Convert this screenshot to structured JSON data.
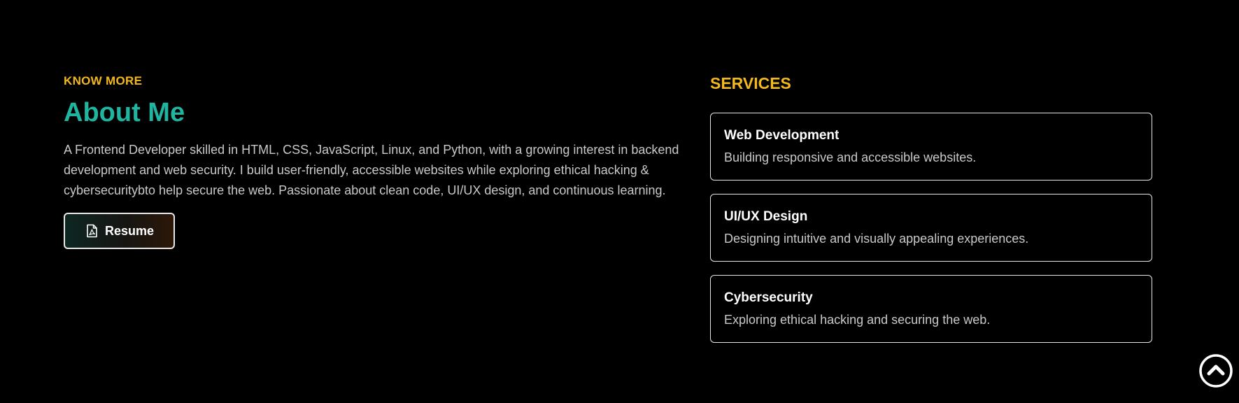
{
  "about": {
    "eyebrow": "KNOW MORE",
    "title": "About Me",
    "description": "A Frontend Developer skilled in HTML, CSS, JavaScript, Linux, and Python, with a growing interest in backend development and web security. I build user-friendly, accessible websites while exploring ethical hacking & cybersecuritybto help secure the web. Passionate about clean code, UI/UX design, and continuous learning.",
    "resume_button": {
      "label": "Resume",
      "icon": "file-pdf-icon"
    }
  },
  "services": {
    "title": "SERVICES",
    "items": [
      {
        "title": "Web Development",
        "description": "Building responsive and accessible websites."
      },
      {
        "title": "UI/UX Design",
        "description": "Designing intuitive and visually appealing experiences."
      },
      {
        "title": "Cybersecurity",
        "description": "Exploring ethical hacking and securing the web."
      }
    ]
  },
  "scroll_top": {
    "icon": "chevron-up-circle-icon"
  },
  "colors": {
    "background": "#000000",
    "accent_yellow": "#f2b81c",
    "accent_teal": "#1fb5a0",
    "text": "#c9c9c9",
    "heading": "#ffffff"
  }
}
